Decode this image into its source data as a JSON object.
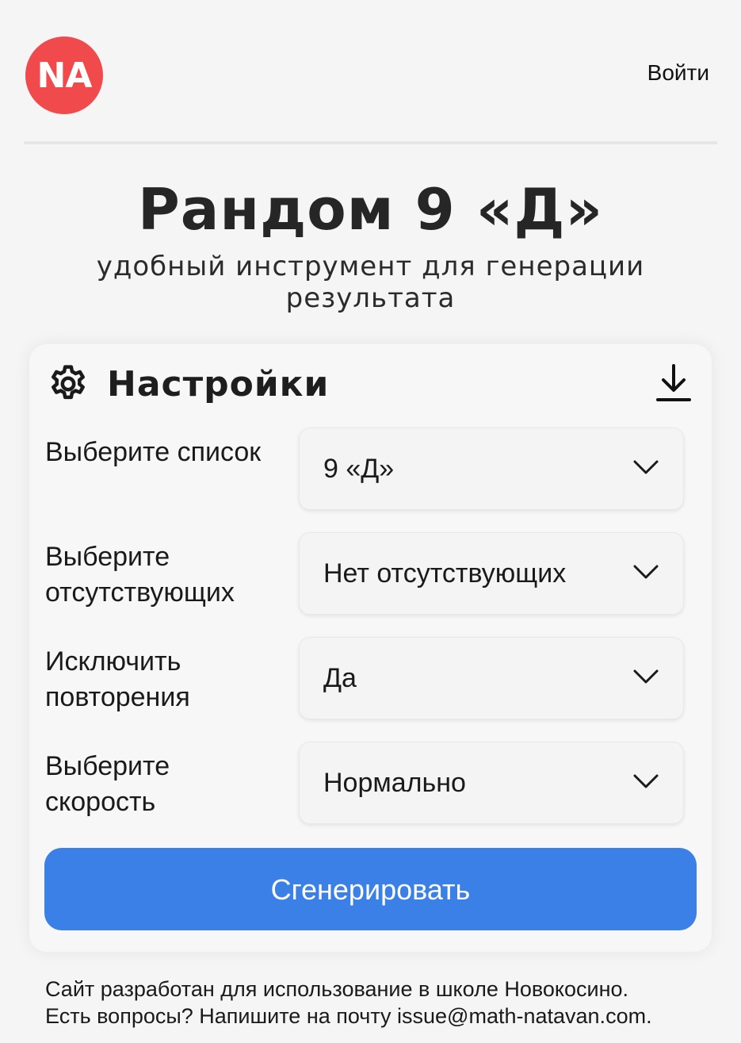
{
  "header": {
    "logo_text": "NA",
    "login_label": "Войти"
  },
  "hero": {
    "title": "Рандом 9 «Д»",
    "subtitle": "удобный инструмент для генерации результата"
  },
  "settings": {
    "title": "Настройки",
    "rows": [
      {
        "label": "Выберите список",
        "value": "9 «Д»"
      },
      {
        "label": "Выберите отсутствующих",
        "value": "Нет отсутствующих"
      },
      {
        "label": "Исключить повторения",
        "value": "Да"
      },
      {
        "label": "Выберите скорость",
        "value": "Нормально"
      }
    ],
    "generate_label": "Сгенерировать"
  },
  "footer": {
    "line1": "Сайт разработан для использование в школе Новокосино.",
    "line2": "Есть вопросы? Напишите на почту issue@math-natavan.com."
  },
  "colors": {
    "logo_bg": "#f04a4d",
    "primary_button": "#3b80e6"
  },
  "icons": {
    "settings": "gear-icon",
    "download": "download-icon",
    "select": "chevron-down-icon"
  }
}
